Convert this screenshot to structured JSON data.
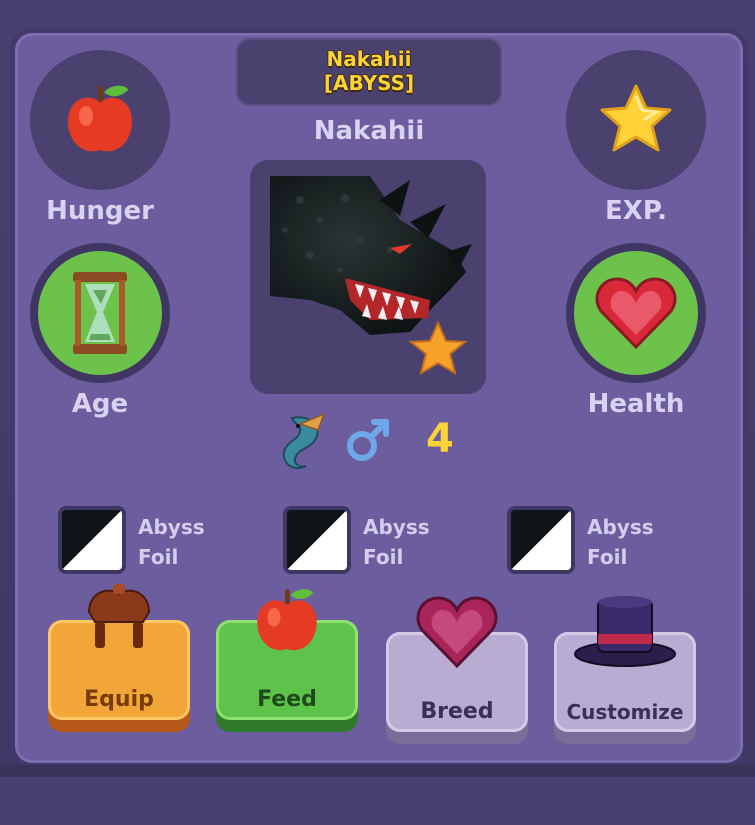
{
  "header": {
    "title_name": "Nakahii",
    "title_tag": "[ABYSS]",
    "pet_name": "Nakahii"
  },
  "stats": {
    "hunger": {
      "label": "Hunger",
      "icon": "apple-icon"
    },
    "exp": {
      "label": "EXP.",
      "icon": "star-icon"
    },
    "age": {
      "label": "Age",
      "icon": "hourglass-icon"
    },
    "health": {
      "label": "Health",
      "icon": "heart-icon"
    }
  },
  "meta": {
    "species_icon": "dragon-icon",
    "gender_icon": "male-symbol-icon",
    "level": "4"
  },
  "traits": [
    {
      "line1": "Abyss",
      "line2": "Foil"
    },
    {
      "line1": "Abyss",
      "line2": "Foil"
    },
    {
      "line1": "Abyss",
      "line2": "Foil"
    }
  ],
  "actions": {
    "equip": "Equip",
    "feed": "Feed",
    "breed": "Breed",
    "customize": "Customize"
  },
  "colors": {
    "panel": "#6c5e9e",
    "panel_dark": "#4b416f",
    "title_gold": "#ffd23a",
    "label": "#d9d2f2",
    "green": "#6cc24a",
    "equip": "#f2a63a",
    "feed": "#5fc24a",
    "breed": "#b8acd2",
    "customize": "#b8acd2"
  }
}
